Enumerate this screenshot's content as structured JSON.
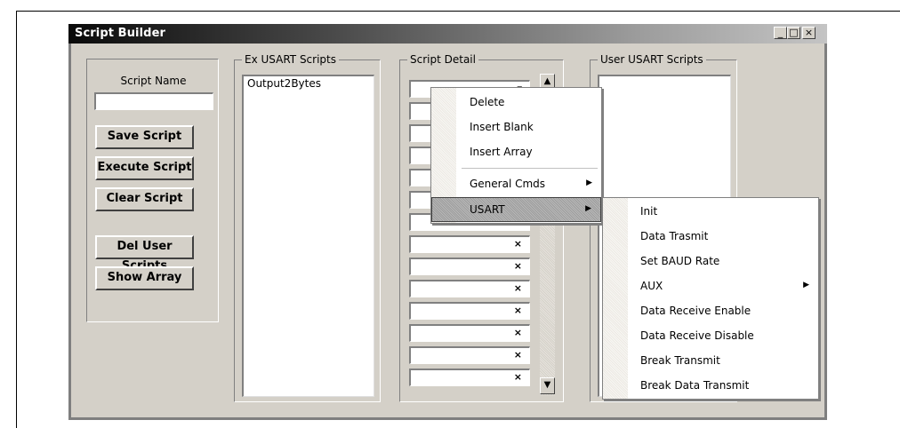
{
  "window": {
    "title": "Script Builder",
    "minimize_glyph": "_",
    "maximize_glyph": "□",
    "close_glyph": "×"
  },
  "left_panel": {
    "script_name_label": "Script Name",
    "script_name_value": "",
    "buttons": {
      "save": "Save Script",
      "execute": "Execute Script",
      "clear": "Clear Script",
      "del_user": "Del User Scripts",
      "show_array": "Show Array"
    }
  },
  "ex_scripts": {
    "label": "Ex USART Scripts",
    "items": [
      "Output2Bytes"
    ]
  },
  "script_detail": {
    "label": "Script Detail",
    "row_remove_glyph": "×",
    "scroll_up_glyph": "▲",
    "scroll_down_glyph": "▼",
    "dropdown_glyph": "▾"
  },
  "user_scripts": {
    "label": "User USART Scripts"
  },
  "context_menu": {
    "items": [
      "Delete",
      "Insert Blank",
      "Insert Array",
      "General Cmds",
      "USART"
    ],
    "submenu_arrow": "▶",
    "highlighted": "USART"
  },
  "usart_submenu": {
    "items": [
      "Init",
      "Data Trasmit",
      "Set BAUD Rate",
      "AUX",
      "Data Receive Enable",
      "Data Receive Disable",
      "Break Transmit",
      "Break Data Transmit"
    ],
    "submenu_arrow": "▶"
  }
}
